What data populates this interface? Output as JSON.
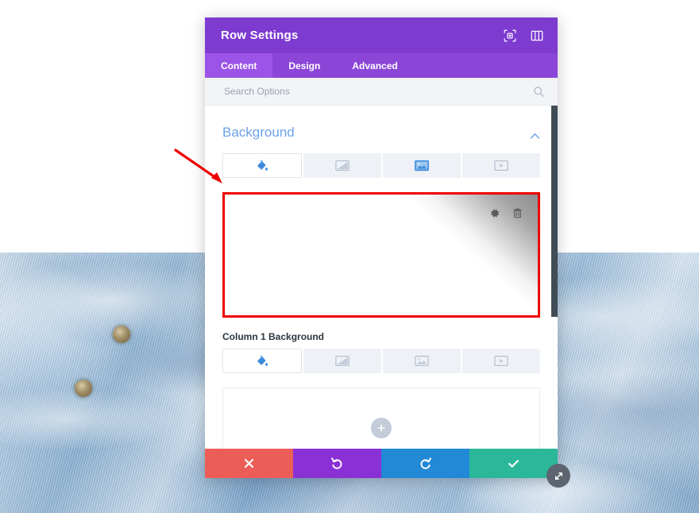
{
  "modal": {
    "title": "Row Settings",
    "titlebar_icons": [
      {
        "name": "focus-target-icon",
        "label": "Focus"
      },
      {
        "name": "layout-panel-icon",
        "label": "Layout"
      }
    ],
    "tabs": [
      {
        "label": "Content",
        "active": true
      },
      {
        "label": "Design",
        "active": false
      },
      {
        "label": "Advanced",
        "active": false
      }
    ],
    "search": {
      "placeholder": "Search Options",
      "value": "",
      "icon": "search-icon"
    },
    "sections": [
      {
        "title": "Background",
        "collapse_icon": "chevron-up-icon",
        "background_type_tabs": [
          {
            "name": "background-color-tab",
            "icon": "paint-bucket-icon",
            "active": true,
            "highlighted": true
          },
          {
            "name": "background-gradient-tab",
            "icon": "gradient-icon",
            "active": false,
            "highlighted": false
          },
          {
            "name": "background-image-tab",
            "icon": "image-icon",
            "active": false,
            "highlighted": true
          },
          {
            "name": "background-video-tab",
            "icon": "video-icon",
            "active": false,
            "highlighted": false
          }
        ],
        "preview": {
          "name": "background-image-preview",
          "actions": [
            {
              "name": "settings-gear-icon",
              "label": "Settings"
            },
            {
              "name": "delete-trash-icon",
              "label": "Delete"
            }
          ]
        }
      },
      {
        "title": "Column 1 Background",
        "background_type_tabs": [
          {
            "name": "column-background-color-tab",
            "icon": "paint-bucket-icon",
            "active": true,
            "highlighted": true
          },
          {
            "name": "column-background-gradient-tab",
            "icon": "gradient-icon",
            "active": false,
            "highlighted": false
          },
          {
            "name": "column-background-image-tab",
            "icon": "image-icon",
            "active": false,
            "highlighted": false
          },
          {
            "name": "column-background-video-tab",
            "icon": "video-icon",
            "active": false,
            "highlighted": false
          }
        ],
        "upload": {
          "name": "column-background-upload-box",
          "add_button_label": "+"
        }
      }
    ],
    "footer_buttons": [
      {
        "name": "cancel-button",
        "icon": "close-x-icon",
        "color": "#ec5d58"
      },
      {
        "name": "undo-button",
        "icon": "undo-arrow-icon",
        "color": "#8a31d6"
      },
      {
        "name": "redo-button",
        "icon": "redo-arrow-icon",
        "color": "#2189d6"
      },
      {
        "name": "save-button",
        "icon": "checkmark-icon",
        "color": "#2bb89a"
      }
    ]
  },
  "annotations": {
    "arrow": {
      "name": "red-arrow-annotation",
      "color": "#ee0000"
    },
    "highlight_box": {
      "name": "red-highlight-box-annotation",
      "color": "#ee0000"
    }
  },
  "resize_handle": {
    "name": "resize-handle",
    "icon": "diagonal-resize-icon"
  },
  "colors": {
    "titlebar": "#7e3bd0",
    "tabbar": "#8b46d8",
    "tab_active": "#9b53e8",
    "section_title": "#6ba2e8",
    "accent_blue": "#3d8bdf",
    "annotation_red": "#ee0000"
  }
}
